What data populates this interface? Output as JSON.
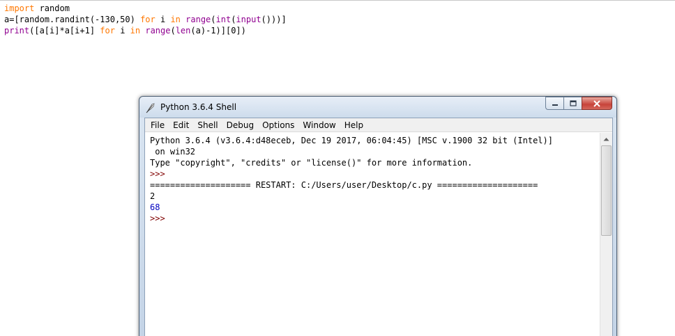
{
  "editor": {
    "lines": [
      [
        {
          "t": "import",
          "c": "kw"
        },
        {
          "t": " random",
          "c": ""
        }
      ],
      [
        {
          "t": "a=[random.randint(-130,50) ",
          "c": ""
        },
        {
          "t": "for",
          "c": "kw"
        },
        {
          "t": " i ",
          "c": ""
        },
        {
          "t": "in",
          "c": "kw"
        },
        {
          "t": " ",
          "c": ""
        },
        {
          "t": "range",
          "c": "bi"
        },
        {
          "t": "(",
          "c": ""
        },
        {
          "t": "int",
          "c": "bi"
        },
        {
          "t": "(",
          "c": ""
        },
        {
          "t": "input",
          "c": "bi"
        },
        {
          "t": "()))]",
          "c": ""
        }
      ],
      [
        {
          "t": "print",
          "c": "bi"
        },
        {
          "t": "([a[i]*a[i+1] ",
          "c": ""
        },
        {
          "t": "for",
          "c": "kw"
        },
        {
          "t": " i ",
          "c": ""
        },
        {
          "t": "in",
          "c": "kw"
        },
        {
          "t": " ",
          "c": ""
        },
        {
          "t": "range",
          "c": "bi"
        },
        {
          "t": "(",
          "c": ""
        },
        {
          "t": "len",
          "c": "bi"
        },
        {
          "t": "(a)-1)][0])",
          "c": ""
        }
      ]
    ]
  },
  "shell": {
    "title": "Python 3.6.4 Shell",
    "menu": [
      "File",
      "Edit",
      "Shell",
      "Debug",
      "Options",
      "Window",
      "Help"
    ],
    "lines": [
      {
        "t": "Python 3.6.4 (v3.6.4:d48eceb, Dec 19 2017, 06:04:45) [MSC v.1900 32 bit (Intel)]",
        "c": ""
      },
      {
        "t": " on win32",
        "c": ""
      },
      {
        "t": "Type \"copyright\", \"credits\" or \"license()\" for more information.",
        "c": ""
      },
      {
        "t": ">>> ",
        "c": "prompt"
      },
      {
        "t": "==================== RESTART: C:/Users/user/Desktop/c.py ====================",
        "c": ""
      },
      {
        "t": "2",
        "c": "out-stdin"
      },
      {
        "t": "68",
        "c": "out-stdout"
      },
      {
        "t": ">>> ",
        "c": "prompt"
      }
    ]
  },
  "colors": {
    "keyword": "#ff7700",
    "builtin": "#900090",
    "prompt": "#800000",
    "stdout": "#0000c0"
  },
  "icons": {
    "app": "python-feather-icon",
    "minimize": "minimize-icon",
    "maximize": "maximize-icon",
    "close": "close-icon",
    "scroll_up": "scroll-up-arrow-icon"
  }
}
